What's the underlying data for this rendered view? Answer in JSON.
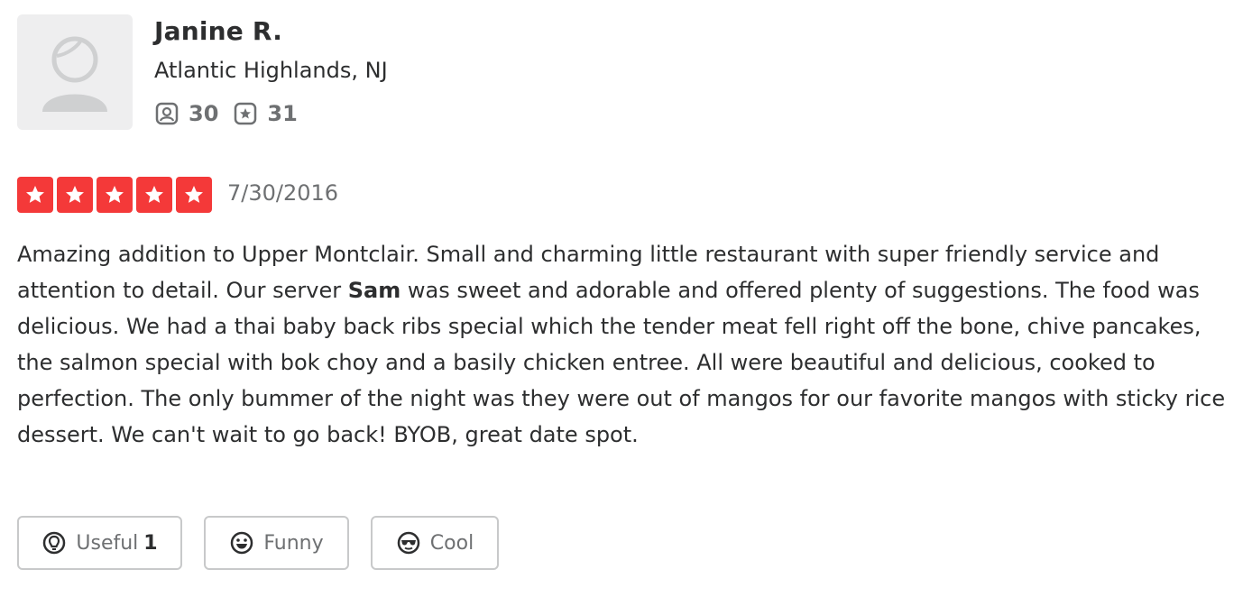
{
  "user": {
    "name": "Janine R.",
    "location": "Atlantic Highlands, NJ",
    "friends_count": "30",
    "reviews_count": "31",
    "friends_icon": "friends-icon",
    "reviews_icon": "star-icon"
  },
  "review": {
    "rating": 5,
    "rating_max": 5,
    "star_color": "#f43939",
    "date": "7/30/2016",
    "text_before": "Amazing addition to Upper Montclair. Small and charming little restaurant with super friendly service and attention to detail. Our server ",
    "text_bold": "Sam",
    "text_after": " was sweet and adorable and offered plenty of suggestions. The food was delicious. We had a thai baby back ribs special which the tender meat fell right off the bone, chive pancakes, the salmon special with bok choy and a basily chicken entree. All were beautiful and delicious, cooked to perfection. The only bummer of the night was they were out of mangos for our favorite mangos with sticky rice dessert. We can't wait to go back! BYOB, great date spot."
  },
  "actions": {
    "useful_label": "Useful",
    "useful_count": "1",
    "funny_label": "Funny",
    "cool_label": "Cool"
  }
}
